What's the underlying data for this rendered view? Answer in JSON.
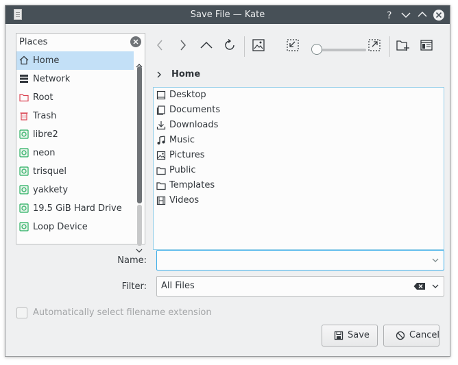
{
  "window": {
    "title": "Save File — Kate"
  },
  "titlebar_buttons": {
    "help": "?"
  },
  "places": {
    "header": "Places",
    "items": [
      {
        "label": "Home",
        "icon": "home-icon",
        "selected": true
      },
      {
        "label": "Network",
        "icon": "network-icon"
      },
      {
        "label": "Root",
        "icon": "root-folder-icon"
      },
      {
        "label": "Trash",
        "icon": "trash-icon"
      },
      {
        "label": "libre2",
        "icon": "drive-icon"
      },
      {
        "label": "neon",
        "icon": "drive-icon"
      },
      {
        "label": "trisquel",
        "icon": "drive-icon"
      },
      {
        "label": "yakkety",
        "icon": "drive-icon"
      },
      {
        "label": "19.5 GiB Hard Drive",
        "icon": "drive-icon"
      },
      {
        "label": "Loop Device",
        "icon": "drive-icon"
      }
    ]
  },
  "breadcrumb": {
    "current": "Home"
  },
  "files": [
    {
      "label": "Desktop",
      "icon": "desktop-icon"
    },
    {
      "label": "Documents",
      "icon": "documents-icon"
    },
    {
      "label": "Downloads",
      "icon": "downloads-icon"
    },
    {
      "label": "Music",
      "icon": "music-icon"
    },
    {
      "label": "Pictures",
      "icon": "pictures-icon"
    },
    {
      "label": "Public",
      "icon": "folder-icon"
    },
    {
      "label": "Templates",
      "icon": "folder-icon"
    },
    {
      "label": "Videos",
      "icon": "videos-icon"
    }
  ],
  "name_field": {
    "label": "Name:",
    "value": ""
  },
  "filter_field": {
    "label": "Filter:",
    "value": "All Files"
  },
  "auto_extension": {
    "label": "Automatically select filename extension",
    "checked": false
  },
  "buttons": {
    "save": "Save",
    "cancel": "Cancel"
  },
  "colors": {
    "titlebar": "#475057",
    "selection": "#c3e0f7",
    "focus": "#3daee9",
    "root_icon": "#da4453"
  }
}
